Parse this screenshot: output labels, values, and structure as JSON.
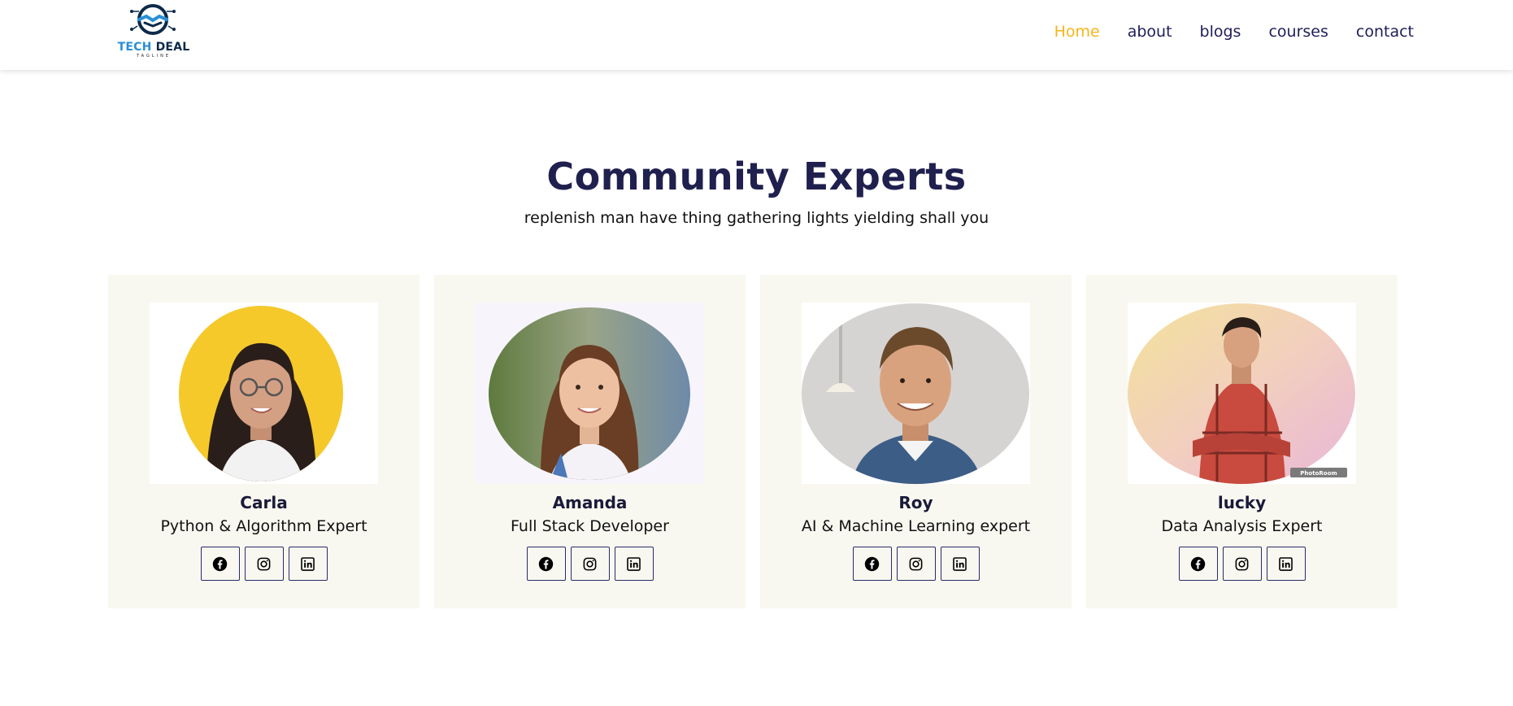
{
  "brand": {
    "name_part1": "TECH",
    "name_part2": "DEAL",
    "tagline": "TAGLINE",
    "primary_color": "#0d2a4a",
    "accent_color": "#2a8fd6"
  },
  "nav": {
    "items": [
      {
        "label": "Home",
        "active": true
      },
      {
        "label": "about",
        "active": false
      },
      {
        "label": "blogs",
        "active": false
      },
      {
        "label": "courses",
        "active": false
      },
      {
        "label": "contact",
        "active": false
      }
    ],
    "active_color": "#f5b51b",
    "link_color": "#1f1d5a"
  },
  "section": {
    "title": "Community Experts",
    "subtitle": "replenish man have thing gathering lights yielding shall you"
  },
  "members": [
    {
      "name": "Carla",
      "role": "Python & Algorithm Expert",
      "photo_background": "#f5c92a",
      "socials": [
        "facebook-icon",
        "instagram-icon",
        "linkedin-icon"
      ]
    },
    {
      "name": "Amanda",
      "role": "Full Stack Developer",
      "photo_background": "#6f8a4a",
      "socials": [
        "facebook-icon",
        "instagram-icon",
        "linkedin-icon"
      ]
    },
    {
      "name": "Roy",
      "role": "AI & Machine Learning expert",
      "photo_background": "#d6d4d2",
      "socials": [
        "facebook-icon",
        "instagram-icon",
        "linkedin-icon"
      ]
    },
    {
      "name": "lucky",
      "role": "Data Analysis Expert",
      "photo_background": "#f1d9b0",
      "photo_watermark": "PhotoRoom",
      "socials": [
        "facebook-icon",
        "instagram-icon",
        "linkedin-icon"
      ]
    }
  ],
  "colors": {
    "title": "#20204f",
    "card_background": "#f8f8f0",
    "button_border": "#2a2a6a"
  }
}
